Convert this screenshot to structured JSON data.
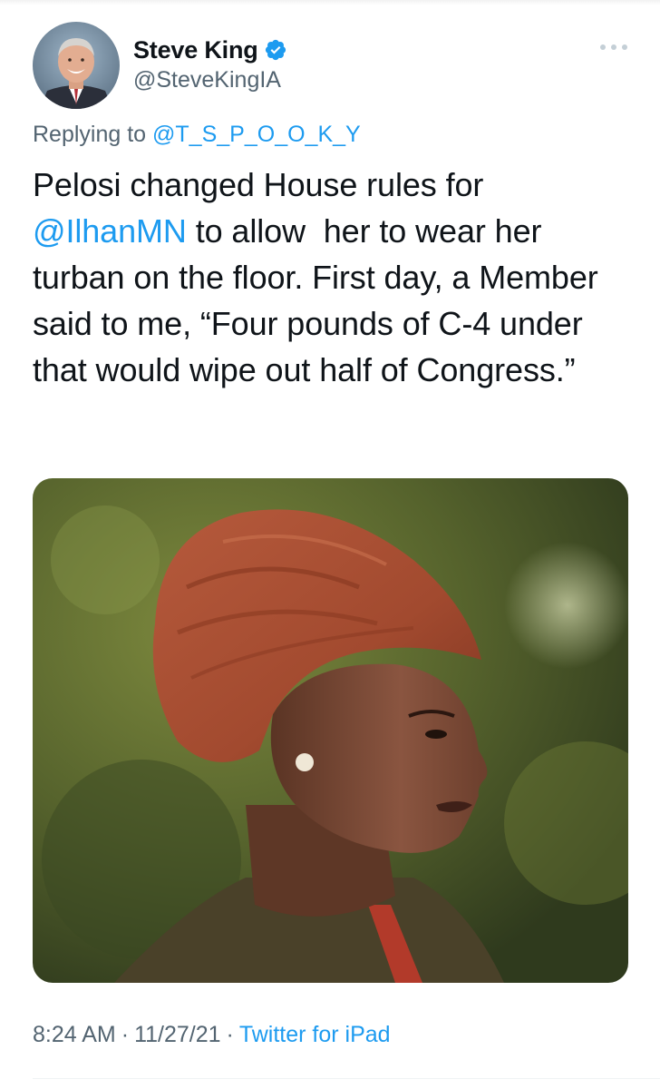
{
  "author": {
    "display_name": "Steve King",
    "handle": "@SteveKingIA",
    "verified": true,
    "avatar_icon": "profile-photo"
  },
  "more_icon": "ellipsis-icon",
  "reply": {
    "prefix": "Replying to ",
    "handle": "@T_S_P_O_O_K_Y"
  },
  "tweet": {
    "text_part1": "Pelosi changed House rules for ",
    "mention": "@IlhanMN",
    "text_part2": " to allow  her to wear her turban on the floor. First day, a Member said to me, “Four pounds of C-4 under that would wipe out half of Congress.”"
  },
  "media": {
    "kind": "photo",
    "alt": "photo of a woman wearing a rust-colored head wrap"
  },
  "meta": {
    "time": "8:24 AM",
    "date": "11/27/21",
    "separator": "·",
    "source": "Twitter for iPad"
  },
  "colors": {
    "link": "#1d9bf0",
    "secondary": "#536471",
    "text": "#0f1419"
  }
}
